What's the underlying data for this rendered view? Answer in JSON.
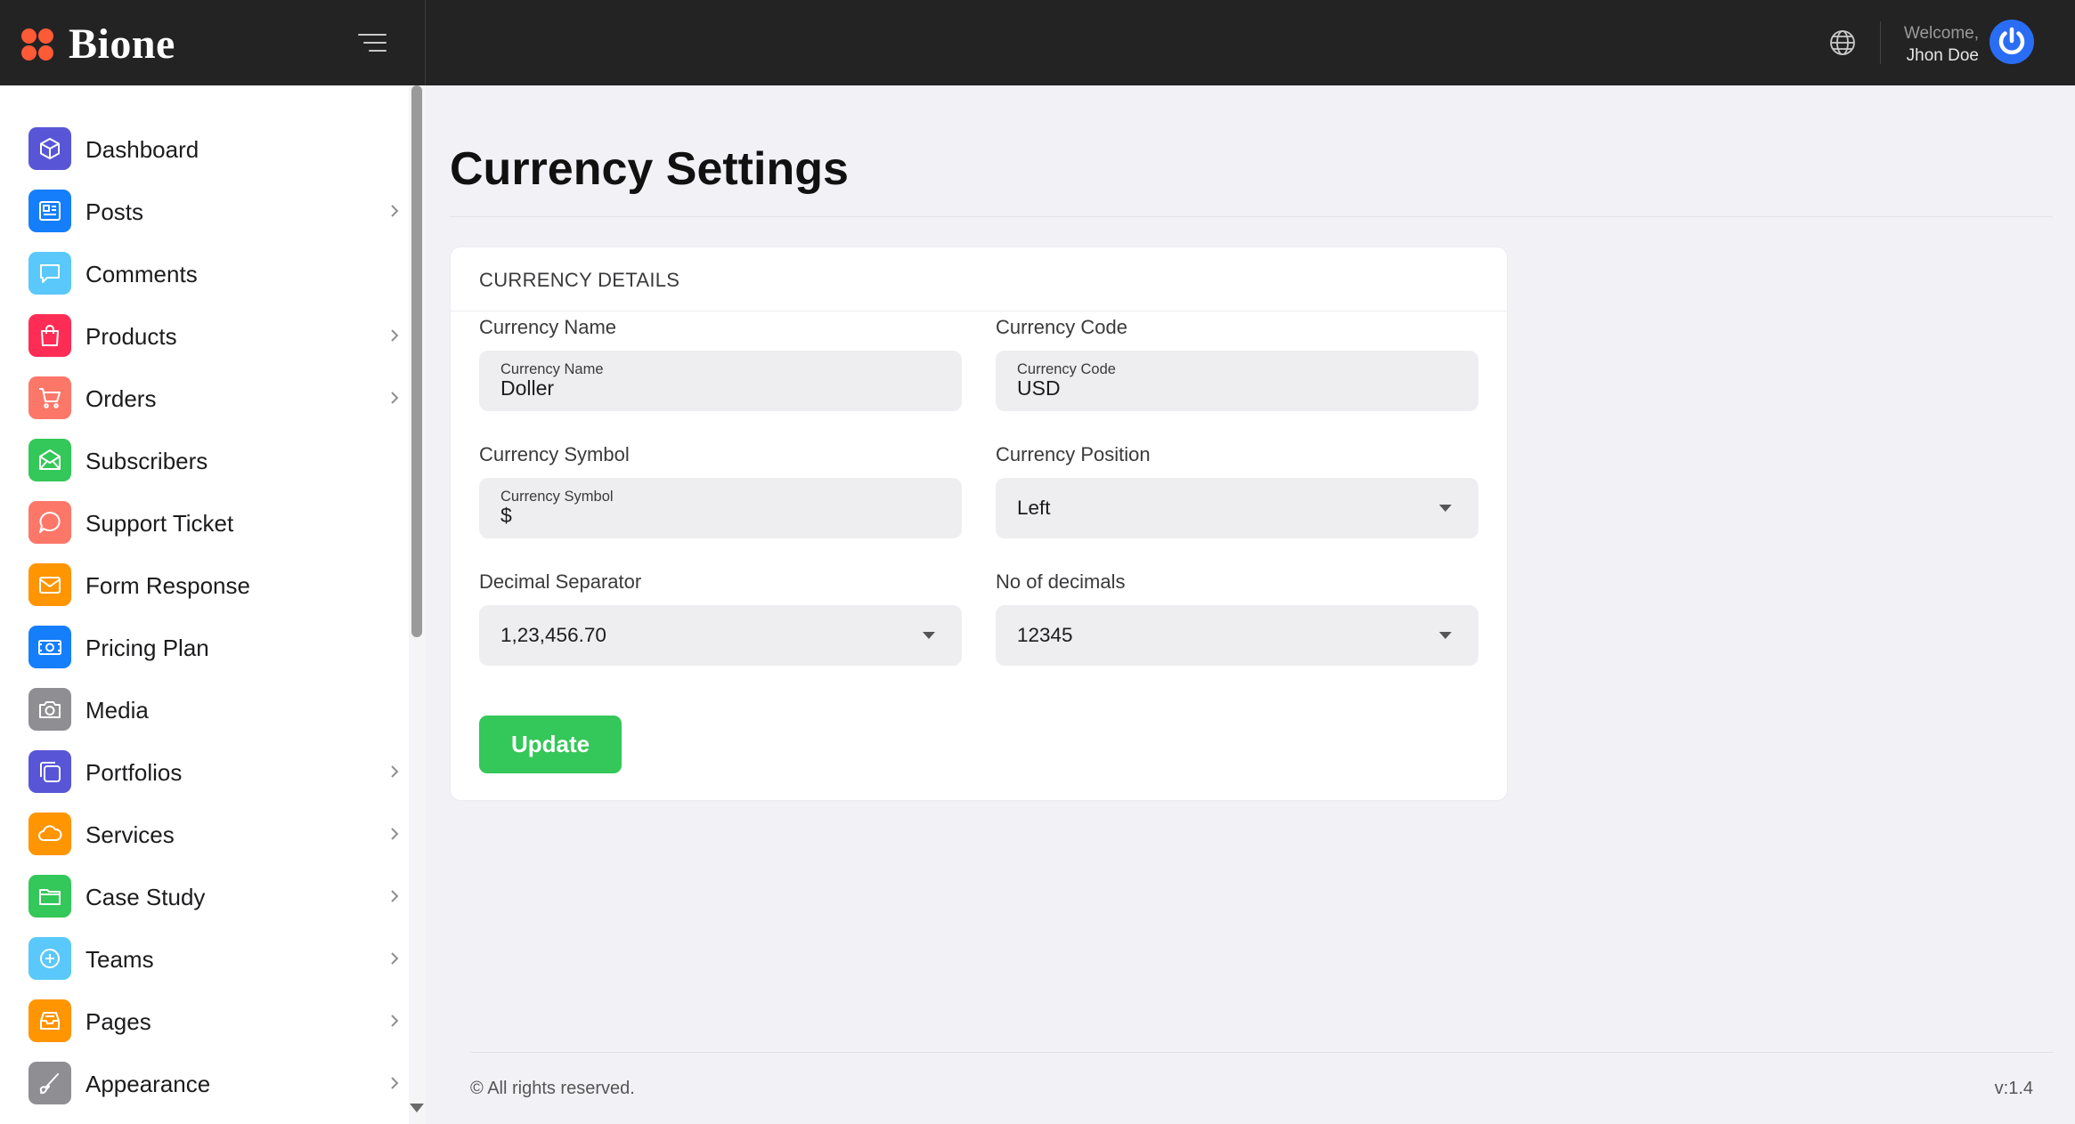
{
  "header": {
    "brand": "Bione",
    "welcome": "Welcome,",
    "user_name": "Jhon Doe",
    "icons": {
      "logo": "bione-logo-icon",
      "menu": "hamburger-menu-icon",
      "language": "globe-icon",
      "avatar": "power-avatar-icon"
    },
    "colors": {
      "bar": "#232323",
      "logo": "#ff5a36",
      "avatar": "#2a6df5"
    }
  },
  "sidebar": {
    "items": [
      {
        "label": "Dashboard",
        "icon": "cube-icon",
        "color": "#5856d6",
        "has_submenu": false
      },
      {
        "label": "Posts",
        "icon": "newspaper-icon",
        "color": "#147efb",
        "has_submenu": true
      },
      {
        "label": "Comments",
        "icon": "chat-icon",
        "color": "#5ac8fa",
        "has_submenu": false
      },
      {
        "label": "Products",
        "icon": "shopping-bag-icon",
        "color": "#ff2d55",
        "has_submenu": true
      },
      {
        "label": "Orders",
        "icon": "cart-icon",
        "color": "#fd7769",
        "has_submenu": true
      },
      {
        "label": "Subscribers",
        "icon": "envelope-icon",
        "color": "#34c759",
        "has_submenu": false
      },
      {
        "label": "Support Ticket",
        "icon": "support-chat-icon",
        "color": "#fd7769",
        "has_submenu": false
      },
      {
        "label": "Form Response",
        "icon": "mail-icon",
        "color": "#ff9500",
        "has_submenu": false
      },
      {
        "label": "Pricing Plan",
        "icon": "money-icon",
        "color": "#147efb",
        "has_submenu": false
      },
      {
        "label": "Media",
        "icon": "camera-icon",
        "color": "#8e8e93",
        "has_submenu": false
      },
      {
        "label": "Portfolios",
        "icon": "copy-icon",
        "color": "#5856d6",
        "has_submenu": true
      },
      {
        "label": "Services",
        "icon": "cloud-icon",
        "color": "#ff9500",
        "has_submenu": true
      },
      {
        "label": "Case Study",
        "icon": "folder-icon",
        "color": "#34c759",
        "has_submenu": true
      },
      {
        "label": "Teams",
        "icon": "plus-circle-icon",
        "color": "#5ac8fa",
        "has_submenu": true
      },
      {
        "label": "Pages",
        "icon": "inbox-icon",
        "color": "#ff9500",
        "has_submenu": true
      },
      {
        "label": "Appearance",
        "icon": "brush-icon",
        "color": "#8e8e93",
        "has_submenu": true
      }
    ]
  },
  "main": {
    "title": "Currency Settings",
    "card_title": "CURRENCY DETAILS",
    "fields": {
      "currency_name": {
        "label": "Currency Name",
        "placeholder": "Currency Name",
        "value": "Doller"
      },
      "currency_code": {
        "label": "Currency Code",
        "placeholder": "Currency Code",
        "value": "USD"
      },
      "currency_symbol": {
        "label": "Currency Symbol",
        "placeholder": "Currency Symbol",
        "value": "$"
      },
      "currency_position": {
        "label": "Currency Position",
        "value": "Left"
      },
      "decimal_separator": {
        "label": "Decimal Separator",
        "value": "1,23,456.70"
      },
      "no_of_decimals": {
        "label": "No of decimals",
        "value": "12345"
      }
    },
    "update_label": "Update",
    "colors": {
      "update_button": "#34c759"
    }
  },
  "footer": {
    "copyright": "© All rights reserved.",
    "version": "v:1.4"
  }
}
